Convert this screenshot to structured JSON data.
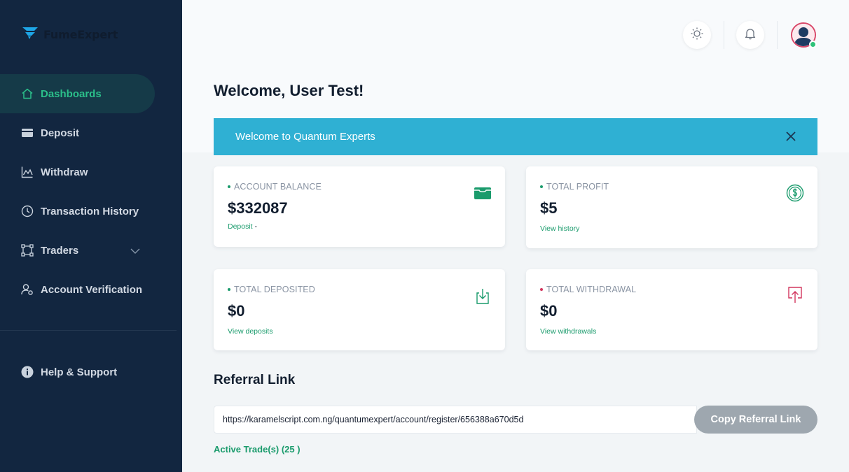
{
  "sidebar": {
    "brand": "FumeExpert",
    "items": [
      {
        "label": "Dashboards",
        "icon": "home-icon"
      },
      {
        "label": "Deposit",
        "icon": "card-icon"
      },
      {
        "label": "Withdraw",
        "icon": "chart-icon"
      },
      {
        "label": "Transaction History",
        "icon": "clock-icon"
      },
      {
        "label": "Traders",
        "icon": "traders-icon"
      },
      {
        "label": "Account Verification",
        "icon": "user-settings-icon"
      }
    ],
    "help": "Help & Support"
  },
  "header": {
    "icons": [
      "sun-icon",
      "bell-icon",
      "avatar"
    ]
  },
  "main": {
    "welcome": "Welcome, User Test!",
    "alert": "Welcome to Quantum Experts",
    "cards": [
      {
        "label": "ACCOUNT BALANCE",
        "value": "$332087",
        "link": "Deposit",
        "link_suffix": " -",
        "dot_color": "#1a9b6c",
        "icon": "wallet-icon"
      },
      {
        "label": "TOTAL PROFIT",
        "value": "$5",
        "link": "View history",
        "dot_color": "#1a9b6c",
        "icon": "dollar-icon"
      },
      {
        "label": "TOTAL DEPOSITED",
        "value": "$0",
        "link": "View deposits",
        "dot_color": "#1a9b6c",
        "icon": "download-icon"
      },
      {
        "label": "TOTAL WITHDRAWAL",
        "value": "$0",
        "link": "View withdrawals",
        "dot_color": "#d2365e",
        "icon": "upload-icon"
      }
    ],
    "referral": {
      "title": "Referral Link",
      "url": "https://karamelscript.com.ng/quantumexpert/account/register/656388a670d5d",
      "button": "Copy Referral Link"
    },
    "active_trades": "Active Trade(s) (25 )"
  },
  "colors": {
    "sidebar_bg": "#122640",
    "accent_green": "#1a9b6c",
    "alert_blue": "#2fb0d3",
    "withdraw_red": "#d2365e"
  }
}
